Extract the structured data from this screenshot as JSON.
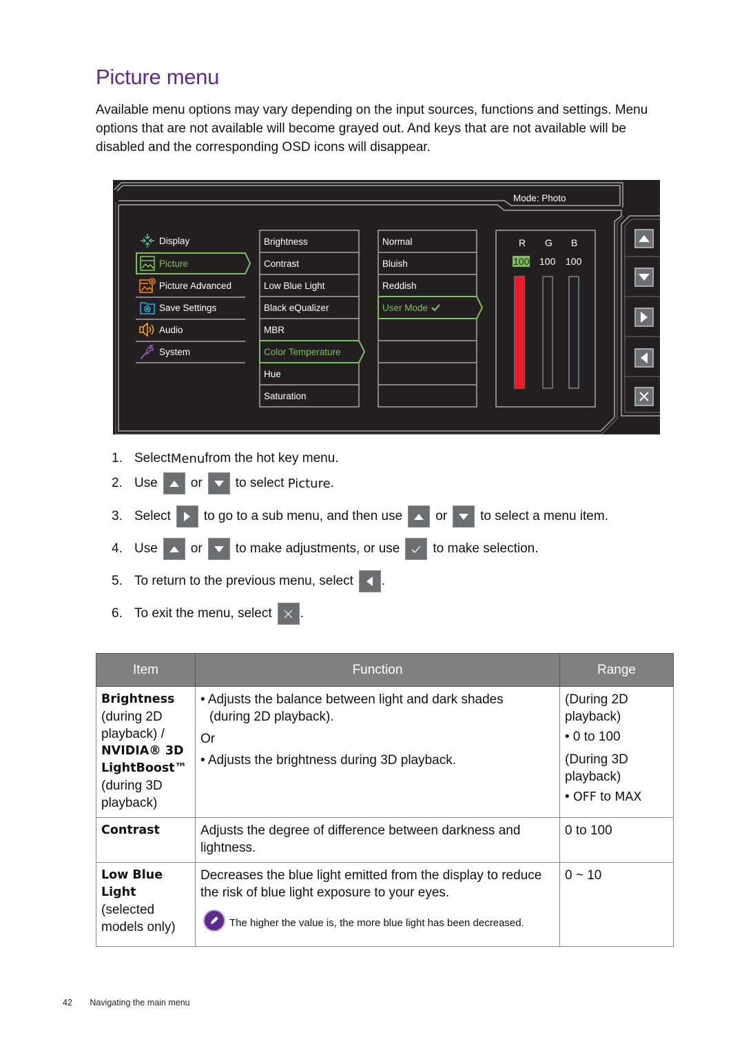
{
  "page": {
    "title": "Picture menu",
    "intro": "Available menu options may vary depending on the input sources, functions and settings. Menu options that are not available will become grayed out. And keys that are not available will be disabled and the corresponding OSD icons will disappear."
  },
  "osd": {
    "mode_label": "Mode: Photo",
    "main_menu": [
      {
        "label": "Display",
        "icon": "display-icon",
        "active": false
      },
      {
        "label": "Picture",
        "icon": "picture-icon",
        "active": true
      },
      {
        "label": "Picture Advanced",
        "icon": "picture-advanced-icon",
        "active": false
      },
      {
        "label": "Save Settings",
        "icon": "save-settings-icon",
        "active": false
      },
      {
        "label": "Audio",
        "icon": "audio-icon",
        "active": false
      },
      {
        "label": "System",
        "icon": "system-icon",
        "active": false
      }
    ],
    "sub_menu": [
      {
        "label": "Brightness",
        "active": false
      },
      {
        "label": "Contrast",
        "active": false
      },
      {
        "label": "Low Blue Light",
        "active": false
      },
      {
        "label": "Black eQualizer",
        "active": false
      },
      {
        "label": "MBR",
        "active": false
      },
      {
        "label": "Color Temperature",
        "active": true
      },
      {
        "label": "Hue",
        "active": false
      },
      {
        "label": "Saturation",
        "active": false
      }
    ],
    "options": [
      {
        "label": "Normal",
        "active": false
      },
      {
        "label": "Bluish",
        "active": false
      },
      {
        "label": "Reddish",
        "active": false
      },
      {
        "label": "User Mode",
        "active": true,
        "checked": true
      },
      {
        "label": "",
        "active": false
      },
      {
        "label": "",
        "active": false
      },
      {
        "label": "",
        "active": false
      },
      {
        "label": "",
        "active": false
      }
    ],
    "rgb": {
      "labels": [
        "R",
        "G",
        "B"
      ],
      "values": [
        "100",
        "100",
        "100"
      ],
      "selected": "R",
      "levels": [
        1.0,
        0.0,
        0.0
      ],
      "colors": {
        "r": "#ed1c24",
        "accent": "#7dc062"
      }
    },
    "keys": [
      "up-key",
      "down-key",
      "right-key",
      "left-key",
      "exit-key"
    ]
  },
  "steps": [
    {
      "num": "1.",
      "parts": {
        "a": "Select ",
        "b": "Menu",
        "c": " from the hot key menu."
      }
    },
    {
      "num": "2.",
      "parts": {
        "a": "Use",
        "or": "or",
        "c": "to select ",
        "b": "Picture",
        "d": "."
      }
    },
    {
      "num": "3.",
      "parts": {
        "a": "Select",
        "c": "to go to a sub menu, and then use",
        "or": "or",
        "d": "to select a menu item."
      }
    },
    {
      "num": "4.",
      "parts": {
        "a": "Use",
        "or": "or",
        "c": "to make adjustments, or use",
        "d": "to make selection."
      }
    },
    {
      "num": "5.",
      "parts": {
        "a": "To return to the previous menu, select",
        "d": "."
      }
    },
    {
      "num": "6.",
      "parts": {
        "a": "To exit the menu, select",
        "d": "."
      }
    }
  ],
  "table": {
    "headers": {
      "item": "Item",
      "function": "Function",
      "range": "Range"
    },
    "rows": [
      {
        "item_bold_1": "Brightness",
        "item_plain_1": "(during 2D playback) /",
        "item_bold_2": "NVIDIA® 3D LightBoost™",
        "item_plain_2": "(during 3D playback)",
        "func_1": "• Adjusts the balance between light and dark shades",
        "func_1b": "(during 2D playback).",
        "func_or": "Or",
        "func_2": "• Adjusts the brightness during 3D playback.",
        "range_1": "(During 2D playback)",
        "range_1v": "• 0 to 100",
        "range_2": "(During 3D playback)",
        "range_2v_prefix": "• ",
        "range_2v": "OFF",
        "range_2v_mid": " to ",
        "range_2v_end": "MAX"
      },
      {
        "item_bold_1": "Contrast",
        "func_1": "Adjusts the degree of difference between darkness and lightness.",
        "range_1": "0 to 100"
      },
      {
        "item_bold_1": "Low Blue Light",
        "item_plain_1": "(selected models only)",
        "func_1": "Decreases the blue light emitted from the display to reduce the risk of blue light exposure to your eyes.",
        "note": "The higher the value is, the more blue light has been decreased.",
        "range_1": "0 ~ 10"
      }
    ]
  },
  "footer": {
    "page_number": "42",
    "section": "Navigating the main menu"
  }
}
